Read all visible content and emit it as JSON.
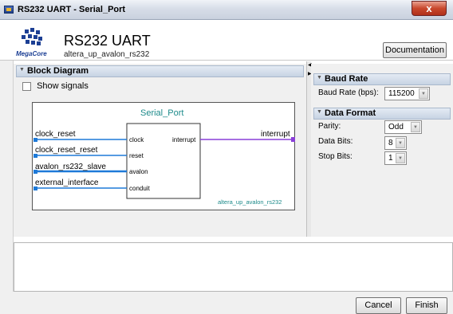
{
  "window": {
    "title": "RS232 UART - Serial_Port",
    "close_label": "x"
  },
  "header": {
    "logo_text": "MegaCore",
    "title": "RS232 UART",
    "subtitle": "altera_up_avalon_rs232",
    "documentation_label": "Documentation"
  },
  "block_diagram": {
    "section_title": "Block Diagram",
    "show_signals_label": "Show signals",
    "component_name": "Serial_Port",
    "module_name": "altera_up_avalon_rs232",
    "left_signals": [
      "clock_reset",
      "clock_reset_reset",
      "avalon_rs232_slave",
      "external_interface"
    ],
    "ports": [
      "clock",
      "reset",
      "avalon",
      "conduit"
    ],
    "output_port": "interrupt",
    "output_signal": "interrupt",
    "colors": {
      "clock_wire": "#1e7ad8",
      "interrupt_wire": "#8a3fd8"
    }
  },
  "baud_rate": {
    "section_title": "Baud Rate",
    "label": "Baud Rate (bps):",
    "value": "115200"
  },
  "data_format": {
    "section_title": "Data Format",
    "parity_label": "Parity:",
    "parity_value": "Odd",
    "data_bits_label": "Data Bits:",
    "data_bits_value": "8",
    "stop_bits_label": "Stop Bits:",
    "stop_bits_value": "1"
  },
  "footer": {
    "cancel_label": "Cancel",
    "finish_label": "Finish"
  }
}
